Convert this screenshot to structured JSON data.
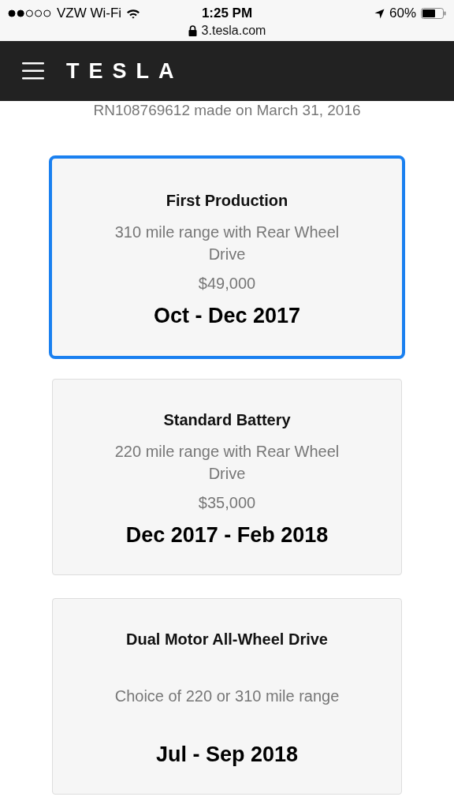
{
  "status_bar": {
    "carrier": "VZW Wi-Fi",
    "time": "1:25 PM",
    "battery": "60%"
  },
  "url_bar": {
    "url": "3.tesla.com"
  },
  "header": {
    "logo": "TESLA"
  },
  "reservation": "RN108769612 made on March 31, 2016",
  "options": [
    {
      "title": "First Production",
      "description": "310 mile range with Rear Wheel Drive",
      "price": "$49,000",
      "delivery": "Oct - Dec 2017",
      "selected": true
    },
    {
      "title": "Standard Battery",
      "description": "220 mile range with Rear Wheel Drive",
      "price": "$35,000",
      "delivery": "Dec 2017 - Feb 2018",
      "selected": false
    },
    {
      "title": "Dual Motor All-Wheel Drive",
      "description": "Choice of 220 or 310 mile range",
      "delivery": "Jul - Sep 2018",
      "selected": false
    }
  ]
}
